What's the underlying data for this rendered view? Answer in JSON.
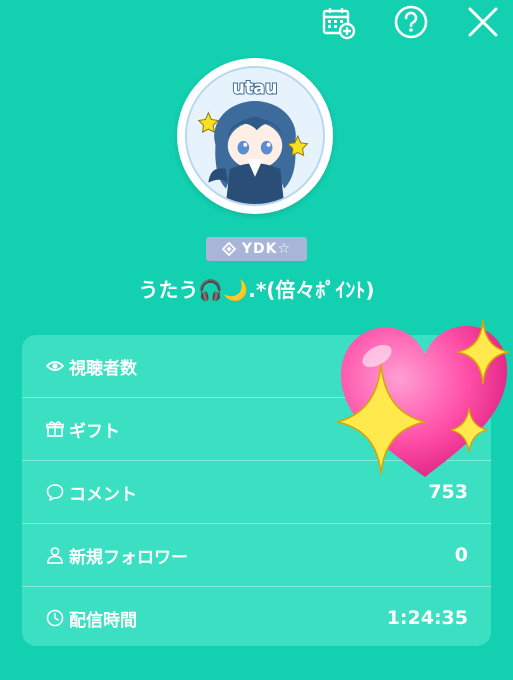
{
  "topbar": {
    "icons": [
      "calendar-add-icon",
      "help-icon",
      "close-icon"
    ]
  },
  "avatar": {
    "logo_text": "utau"
  },
  "badge": {
    "text": "YDK☆"
  },
  "username": "うたう🎧🌙.*(倍々ﾎﾟｲﾝﾄ)",
  "stats": [
    {
      "icon": "eye-icon",
      "label": "視聴者数",
      "value": ""
    },
    {
      "icon": "gift-icon",
      "label": "ギフト",
      "value": ""
    },
    {
      "icon": "comment-icon",
      "label": "コメント",
      "value": "753"
    },
    {
      "icon": "person-icon",
      "label": "新規フォロワー",
      "value": "0"
    },
    {
      "icon": "clock-icon",
      "label": "配信時間",
      "value": "1:24:35"
    }
  ],
  "colors": {
    "background": "#12d0b0",
    "panel": "#3be0c3",
    "badge": "#a8b4d8"
  }
}
